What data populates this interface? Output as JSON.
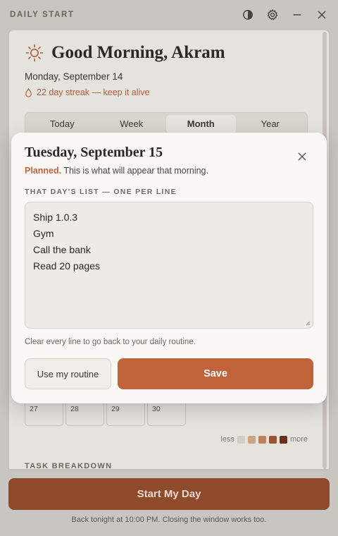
{
  "window": {
    "app_name": "DAILY START",
    "controls": [
      {
        "name": "theme-toggle",
        "icon": "contrast-icon"
      },
      {
        "name": "settings",
        "icon": "gear-icon"
      },
      {
        "name": "minimize",
        "icon": "minimize-icon"
      },
      {
        "name": "close",
        "icon": "close-icon"
      }
    ]
  },
  "header": {
    "icon": "sun-icon",
    "greeting": "Good Morning, Akram",
    "date": "Monday, September 14",
    "streak": "22 day streak — keep it alive"
  },
  "tabs": [
    {
      "label": "Today",
      "active": false
    },
    {
      "label": "Week",
      "active": false
    },
    {
      "label": "Month",
      "active": true
    },
    {
      "label": "Year",
      "active": false
    }
  ],
  "calendar": {
    "visible_days": [
      "27",
      "28",
      "29",
      "30"
    ],
    "legend": {
      "less": "less",
      "more": "more",
      "colors": [
        "#e2ded8",
        "#ddb08c",
        "#cf8a5c",
        "#a95533",
        "#6e2e18"
      ]
    }
  },
  "breakdown": {
    "title": "TASK BREAKDOWN"
  },
  "modal": {
    "title": "Tuesday, September 15",
    "status_word": "Planned.",
    "status_text": " This is what will appear that morning.",
    "list_label": "THAT DAY'S LIST — ONE PER LINE",
    "tasks": [
      "Ship 1.0.3",
      "Gym",
      "Call the bank",
      "Read 20 pages"
    ],
    "hint": "Clear every line to go back to your daily routine.",
    "routine_button": "Use my routine",
    "save_button": "Save"
  },
  "footer": {
    "start_button": "Start My Day",
    "note": "Back tonight at 10:00 PM. Closing the window works too."
  },
  "colors": {
    "accent": "#c0623a",
    "accent_dark": "#8f4a2c",
    "background": "#d8d6d1",
    "card": "#f8f6f2"
  }
}
